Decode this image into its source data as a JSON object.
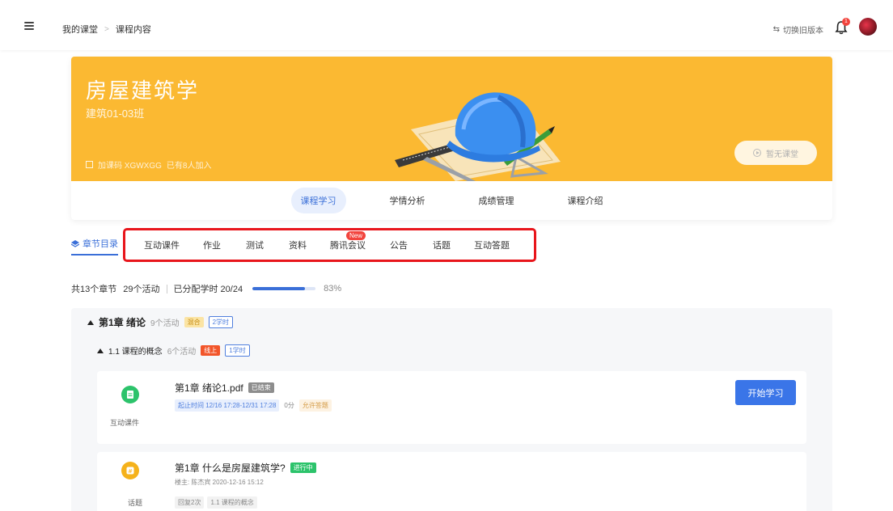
{
  "topbar": {
    "breadcrumb": [
      "我的课堂",
      "课程内容"
    ],
    "switch_label": "切换旧版本",
    "notification_count": "1"
  },
  "course": {
    "title": "房屋建筑学",
    "class_name": "建筑01-03班",
    "code_text": "加课码 XGWXGG",
    "joined_text": "已有8人加入",
    "no_class_label": "暂无课堂",
    "tabs": [
      "课程学习",
      "学情分析",
      "成绩管理",
      "课程介绍"
    ],
    "active_tab": "课程学习"
  },
  "subtabs": {
    "directory": "章节目录",
    "items": [
      "互动课件",
      "作业",
      "测试",
      "资料",
      "腾讯会议",
      "公告",
      "话题",
      "互动答题"
    ],
    "new_badge": "New"
  },
  "stats": {
    "chapters": "共13个章节",
    "activities": "29个活动",
    "hours": "已分配学时 20/24",
    "progress_percent": 83,
    "progress_label": "83%"
  },
  "chapter": {
    "title": "第1章 绪论",
    "activity_count": "9个活动",
    "mode_tag": "混合",
    "hours_tag": "2学时",
    "section": {
      "title": "1.1 课程的概念",
      "activity_count": "6个活动",
      "mode_tag": "线上",
      "hours_tag": "1学时"
    },
    "items": [
      {
        "type": "互动课件",
        "name": "第1章 绪论1.pdf",
        "status": "已结束",
        "time": "起止时间 12/16 17:28-12/31 17:28",
        "score": "0分",
        "allow": "允许答题",
        "action": "开始学习",
        "icon_color": "#2cc36b"
      },
      {
        "type": "话题",
        "name": "第1章 什么是房屋建筑学?",
        "status": "进行中",
        "host": "楼主: 陈杰宾  2020-12-16 15:12",
        "replies": "回复2次",
        "section_ref": "1.1 课程的概念",
        "icon_color": "#f5b21b"
      }
    ]
  },
  "colors": {
    "banner": "#fbb932",
    "accent": "#3a6fd8",
    "highlight_box": "#e8151b"
  }
}
